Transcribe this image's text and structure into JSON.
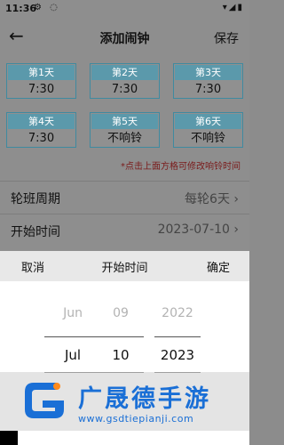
{
  "status_bar": {
    "time": "11:36",
    "left_icons": "⚙ ◌",
    "right_icons": "▾◢▮"
  },
  "nav": {
    "back_icon": "arrow-left-icon",
    "title": "添加闹钟",
    "save_label": "保存"
  },
  "days": [
    {
      "label": "第1天",
      "value": "7:30"
    },
    {
      "label": "第2天",
      "value": "7:30"
    },
    {
      "label": "第3天",
      "value": "7:30"
    },
    {
      "label": "第4天",
      "value": "7:30"
    },
    {
      "label": "第5天",
      "value": "不响铃"
    },
    {
      "label": "第6天",
      "value": "不响铃"
    }
  ],
  "hint": "*点击上面方格可修改响铃时间",
  "rows": {
    "cycle_label": "轮班周期",
    "cycle_value": "每轮6天 ›",
    "start_label": "开始时间",
    "start_value": "2023-07-10 ›"
  },
  "picker": {
    "cancel": "取消",
    "title": "开始时间",
    "confirm": "确定",
    "month_prev": "Jun",
    "month_sel": "Jul",
    "day_prev": "09",
    "day_sel": "10",
    "year_prev": "2022",
    "year_sel": "2023"
  },
  "watermark": {
    "brand": "广晟德手游",
    "url": "www.gsdtiepianji.com"
  },
  "colors": {
    "accent": "#5b99ab",
    "hint": "#7a1a1a",
    "brand": "#1a6fd6"
  }
}
